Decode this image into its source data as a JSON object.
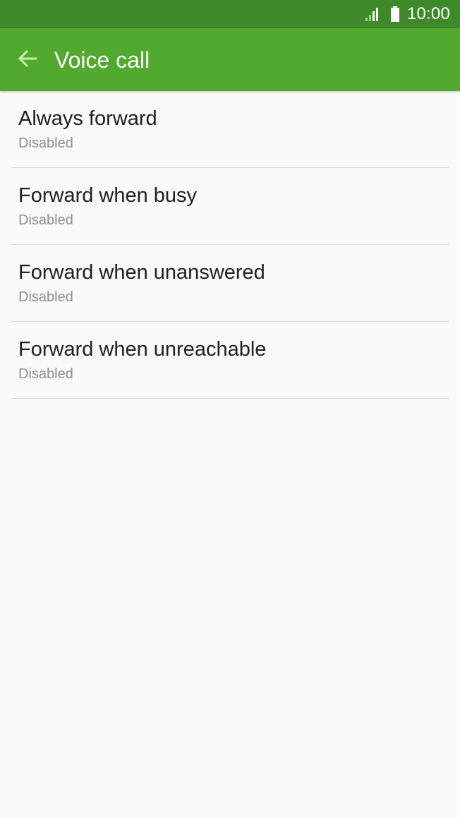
{
  "status_bar": {
    "time": "10:00",
    "signal_icon": "signal-icon",
    "battery_icon": "battery-icon",
    "background": "#3e8a2a"
  },
  "app_bar": {
    "title": "Voice call",
    "back_icon": "arrow-left-icon",
    "background": "#52a930",
    "back_icon_color": "#c8f0a0"
  },
  "items": [
    {
      "title": "Always forward",
      "subtitle": "Disabled"
    },
    {
      "title": "Forward when busy",
      "subtitle": "Disabled"
    },
    {
      "title": "Forward when unanswered",
      "subtitle": "Disabled"
    },
    {
      "title": "Forward when unreachable",
      "subtitle": "Disabled"
    }
  ]
}
